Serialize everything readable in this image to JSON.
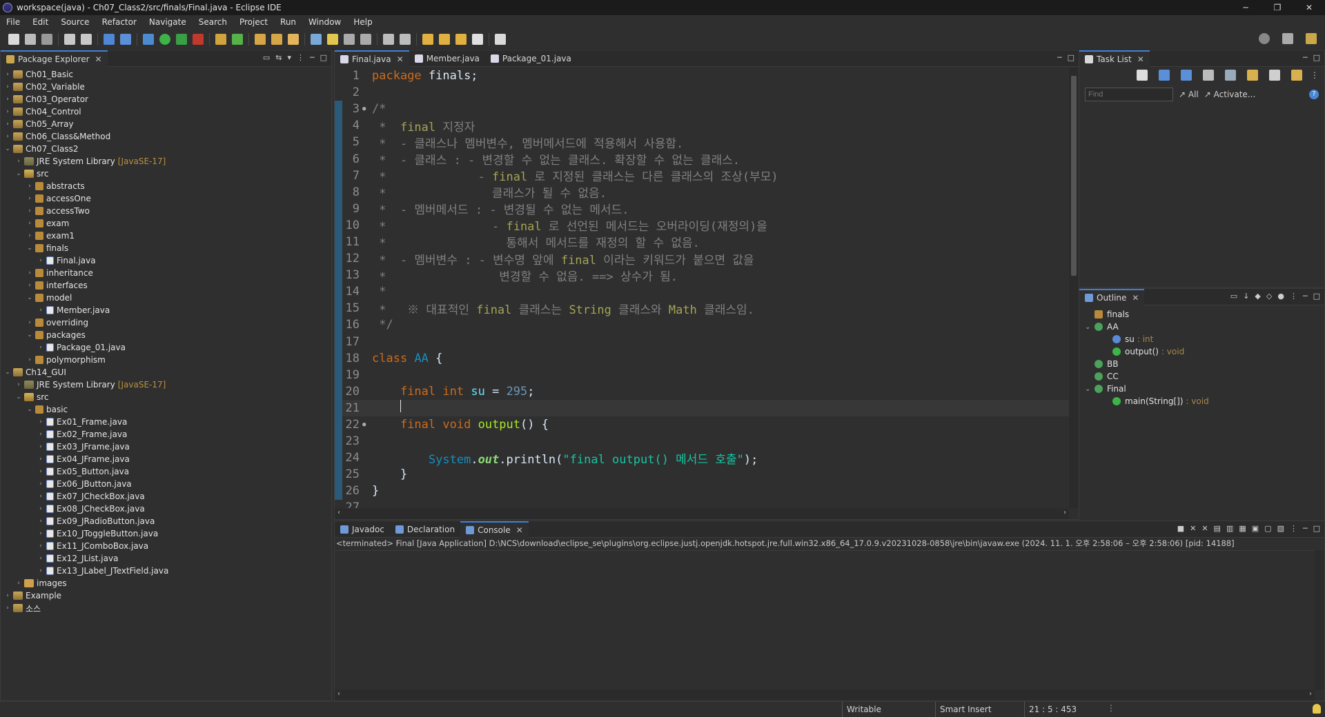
{
  "window": {
    "title": "workspace(java) - Ch07_Class2/src/finals/Final.java - Eclipse IDE",
    "controls": [
      "─",
      "❐",
      "✕"
    ]
  },
  "menu": [
    "File",
    "Edit",
    "Source",
    "Refactor",
    "Navigate",
    "Search",
    "Project",
    "Run",
    "Window",
    "Help"
  ],
  "package_explorer": {
    "tab_label": "Package Explorer",
    "nodes": [
      {
        "label": "Ch01_Basic",
        "depth": 0,
        "twisty": "›",
        "icon": "project-icon"
      },
      {
        "label": "Ch02_Variable",
        "depth": 0,
        "twisty": "›",
        "icon": "project-icon"
      },
      {
        "label": "Ch03_Operator",
        "depth": 0,
        "twisty": "›",
        "icon": "project-icon"
      },
      {
        "label": "Ch04_Control",
        "depth": 0,
        "twisty": "›",
        "icon": "project-icon"
      },
      {
        "label": "Ch05_Array",
        "depth": 0,
        "twisty": "›",
        "icon": "project-icon"
      },
      {
        "label": "Ch06_Class&Method",
        "depth": 0,
        "twisty": "›",
        "icon": "project-icon"
      },
      {
        "label": "Ch07_Class2",
        "depth": 0,
        "twisty": "⌄",
        "icon": "project-icon"
      },
      {
        "label": "JRE System Library",
        "suffix": "[JavaSE-17]",
        "depth": 1,
        "twisty": "›",
        "icon": "library-icon"
      },
      {
        "label": "src",
        "depth": 1,
        "twisty": "⌄",
        "icon": "source-folder-icon"
      },
      {
        "label": "abstracts",
        "depth": 2,
        "twisty": "›",
        "icon": "package-icon"
      },
      {
        "label": "accessOne",
        "depth": 2,
        "twisty": "›",
        "icon": "package-icon"
      },
      {
        "label": "accessTwo",
        "depth": 2,
        "twisty": "›",
        "icon": "package-icon"
      },
      {
        "label": "exam",
        "depth": 2,
        "twisty": "›",
        "icon": "package-icon"
      },
      {
        "label": "exam1",
        "depth": 2,
        "twisty": "›",
        "icon": "package-icon"
      },
      {
        "label": "finals",
        "depth": 2,
        "twisty": "⌄",
        "icon": "package-icon"
      },
      {
        "label": "Final.java",
        "depth": 3,
        "twisty": "›",
        "icon": "java-file-icon"
      },
      {
        "label": "inheritance",
        "depth": 2,
        "twisty": "›",
        "icon": "package-icon"
      },
      {
        "label": "interfaces",
        "depth": 2,
        "twisty": "›",
        "icon": "package-icon"
      },
      {
        "label": "model",
        "depth": 2,
        "twisty": "⌄",
        "icon": "package-icon"
      },
      {
        "label": "Member.java",
        "depth": 3,
        "twisty": "›",
        "icon": "java-file-icon"
      },
      {
        "label": "overriding",
        "depth": 2,
        "twisty": "›",
        "icon": "package-icon"
      },
      {
        "label": "packages",
        "depth": 2,
        "twisty": "⌄",
        "icon": "package-icon"
      },
      {
        "label": "Package_01.java",
        "depth": 3,
        "twisty": "›",
        "icon": "java-file-icon"
      },
      {
        "label": "polymorphism",
        "depth": 2,
        "twisty": "›",
        "icon": "package-icon"
      },
      {
        "label": "Ch14_GUI",
        "depth": 0,
        "twisty": "⌄",
        "icon": "project-icon"
      },
      {
        "label": "JRE System Library",
        "suffix": "[JavaSE-17]",
        "depth": 1,
        "twisty": "›",
        "icon": "library-icon"
      },
      {
        "label": "src",
        "depth": 1,
        "twisty": "⌄",
        "icon": "source-folder-icon"
      },
      {
        "label": "basic",
        "depth": 2,
        "twisty": "⌄",
        "icon": "package-icon"
      },
      {
        "label": "Ex01_Frame.java",
        "depth": 3,
        "twisty": "›",
        "icon": "java-file-icon"
      },
      {
        "label": "Ex02_Frame.java",
        "depth": 3,
        "twisty": "›",
        "icon": "java-file-icon"
      },
      {
        "label": "Ex03_JFrame.java",
        "depth": 3,
        "twisty": "›",
        "icon": "java-file-icon"
      },
      {
        "label": "Ex04_JFrame.java",
        "depth": 3,
        "twisty": "›",
        "icon": "java-file-icon"
      },
      {
        "label": "Ex05_Button.java",
        "depth": 3,
        "twisty": "›",
        "icon": "java-file-icon"
      },
      {
        "label": "Ex06_JButton.java",
        "depth": 3,
        "twisty": "›",
        "icon": "java-file-icon"
      },
      {
        "label": "Ex07_JCheckBox.java",
        "depth": 3,
        "twisty": "›",
        "icon": "java-file-icon"
      },
      {
        "label": "Ex08_JCheckBox.java",
        "depth": 3,
        "twisty": "›",
        "icon": "java-file-icon"
      },
      {
        "label": "Ex09_JRadioButton.java",
        "depth": 3,
        "twisty": "›",
        "icon": "java-file-icon"
      },
      {
        "label": "Ex10_JToggleButton.java",
        "depth": 3,
        "twisty": "›",
        "icon": "java-file-icon"
      },
      {
        "label": "Ex11_JComboBox.java",
        "depth": 3,
        "twisty": "›",
        "icon": "java-file-icon"
      },
      {
        "label": "Ex12_JList.java",
        "depth": 3,
        "twisty": "›",
        "icon": "java-file-icon"
      },
      {
        "label": "Ex13_JLabel_JTextField.java",
        "depth": 3,
        "twisty": "›",
        "icon": "java-file-icon"
      },
      {
        "label": "images",
        "depth": 1,
        "twisty": "›",
        "icon": "folder-icon"
      },
      {
        "label": "Example",
        "depth": 0,
        "twisty": "›",
        "icon": "project-icon"
      },
      {
        "label": "소스",
        "depth": 0,
        "twisty": "›",
        "icon": "project-icon"
      }
    ]
  },
  "editor": {
    "tabs": [
      {
        "label": "Final.java",
        "active": true
      },
      {
        "label": "Member.java",
        "active": false
      },
      {
        "label": "Package_01.java",
        "active": false
      }
    ],
    "lines": [
      {
        "n": "1",
        "fold": "",
        "tokens": [
          {
            "t": "package",
            "c": "kw"
          },
          {
            "t": " finals;",
            "c": "pln"
          }
        ]
      },
      {
        "n": "2",
        "fold": "",
        "tokens": []
      },
      {
        "n": "3",
        "fold": "●",
        "tokens": [
          {
            "t": "/*",
            "c": "cm"
          }
        ]
      },
      {
        "n": "4",
        "fold": "",
        "tokens": [
          {
            "t": " *  ",
            "c": "cm"
          },
          {
            "t": "final",
            "c": "cmk"
          },
          {
            "t": " 지정자",
            "c": "cm"
          }
        ]
      },
      {
        "n": "5",
        "fold": "",
        "tokens": [
          {
            "t": " *  - 클래스나 멤버변수, 멤버메서드에 적용해서 사용함.",
            "c": "cm"
          }
        ]
      },
      {
        "n": "6",
        "fold": "",
        "tokens": [
          {
            "t": " *  - 클래스 : - 변경할 수 없는 클래스. 확장할 수 없는 클래스.",
            "c": "cm"
          }
        ]
      },
      {
        "n": "7",
        "fold": "",
        "tokens": [
          {
            "t": " *             - ",
            "c": "cm"
          },
          {
            "t": "final",
            "c": "cmk"
          },
          {
            "t": " 로 지정된 클래스는 다른 클래스의 조상(부모)",
            "c": "cm"
          }
        ]
      },
      {
        "n": "8",
        "fold": "",
        "tokens": [
          {
            "t": " *               클래스가 될 수 없음.",
            "c": "cm"
          }
        ]
      },
      {
        "n": "9",
        "fold": "",
        "tokens": [
          {
            "t": " *  - 멤버메서드 : - 변경될 수 없는 메서드.",
            "c": "cm"
          }
        ]
      },
      {
        "n": "10",
        "fold": "",
        "tokens": [
          {
            "t": " *               - ",
            "c": "cm"
          },
          {
            "t": "final",
            "c": "cmk"
          },
          {
            "t": " 로 선언된 메서드는 오버라이딩(재정의)을",
            "c": "cm"
          }
        ]
      },
      {
        "n": "11",
        "fold": "",
        "tokens": [
          {
            "t": " *                 통해서 메서드를 재정의 할 수 없음.",
            "c": "cm"
          }
        ]
      },
      {
        "n": "12",
        "fold": "",
        "tokens": [
          {
            "t": " *  - 멤버변수 : - 변수명 앞에 ",
            "c": "cm"
          },
          {
            "t": "final",
            "c": "cmk"
          },
          {
            "t": " 이라는 키워드가 붙으면 값을",
            "c": "cm"
          }
        ]
      },
      {
        "n": "13",
        "fold": "",
        "tokens": [
          {
            "t": " *                변경할 수 없음. ==> 상수가 됨.",
            "c": "cm"
          }
        ]
      },
      {
        "n": "14",
        "fold": "",
        "tokens": [
          {
            "t": " *",
            "c": "cm"
          }
        ]
      },
      {
        "n": "15",
        "fold": "",
        "tokens": [
          {
            "t": " *   ※ 대표적인 ",
            "c": "cm"
          },
          {
            "t": "final",
            "c": "cmk"
          },
          {
            "t": " 클래스는 ",
            "c": "cm"
          },
          {
            "t": "String",
            "c": "cmk"
          },
          {
            "t": " 클래스와 ",
            "c": "cm"
          },
          {
            "t": "Math",
            "c": "cmk"
          },
          {
            "t": " 클래스임.",
            "c": "cm"
          }
        ]
      },
      {
        "n": "16",
        "fold": "",
        "tokens": [
          {
            "t": " */",
            "c": "cm"
          }
        ]
      },
      {
        "n": "17",
        "fold": "",
        "tokens": []
      },
      {
        "n": "18",
        "fold": "",
        "tokens": [
          {
            "t": "class",
            "c": "kw"
          },
          {
            "t": " ",
            "c": "pln"
          },
          {
            "t": "AA",
            "c": "cls"
          },
          {
            "t": " {",
            "c": "pln"
          }
        ]
      },
      {
        "n": "19",
        "fold": "",
        "tokens": []
      },
      {
        "n": "20",
        "fold": "",
        "tokens": [
          {
            "t": "    ",
            "c": "pln"
          },
          {
            "t": "final",
            "c": "kw"
          },
          {
            "t": " ",
            "c": "pln"
          },
          {
            "t": "int",
            "c": "kw"
          },
          {
            "t": " ",
            "c": "pln"
          },
          {
            "t": "su",
            "c": "fld"
          },
          {
            "t": " = ",
            "c": "pln"
          },
          {
            "t": "295",
            "c": "num"
          },
          {
            "t": ";",
            "c": "pln"
          }
        ]
      },
      {
        "n": "21",
        "fold": "",
        "tokens": [
          {
            "t": "    ",
            "c": "pln"
          }
        ],
        "caret": true
      },
      {
        "n": "22",
        "fold": "●",
        "tokens": [
          {
            "t": "    ",
            "c": "pln"
          },
          {
            "t": "final",
            "c": "kw"
          },
          {
            "t": " ",
            "c": "pln"
          },
          {
            "t": "void",
            "c": "kw"
          },
          {
            "t": " ",
            "c": "pln"
          },
          {
            "t": "output",
            "c": "mth"
          },
          {
            "t": "() {",
            "c": "pln"
          }
        ]
      },
      {
        "n": "23",
        "fold": "",
        "tokens": []
      },
      {
        "n": "24",
        "fold": "",
        "tokens": [
          {
            "t": "        ",
            "c": "pln"
          },
          {
            "t": "System",
            "c": "cls"
          },
          {
            "t": ".",
            "c": "pln"
          },
          {
            "t": "out",
            "c": "sta"
          },
          {
            "t": ".println(",
            "c": "pln"
          },
          {
            "t": "\"final output() 메서드 호출\"",
            "c": "str"
          },
          {
            "t": ");",
            "c": "pln"
          }
        ]
      },
      {
        "n": "25",
        "fold": "",
        "tokens": [
          {
            "t": "    }",
            "c": "pln"
          }
        ]
      },
      {
        "n": "26",
        "fold": "",
        "tokens": [
          {
            "t": "}",
            "c": "pln"
          }
        ]
      },
      {
        "n": "27",
        "fold": "",
        "tokens": []
      }
    ],
    "current_line": "21"
  },
  "task_list": {
    "tab_label": "Task List",
    "find_placeholder": "Find",
    "all_label": "All",
    "activate_label": "Activate..."
  },
  "outline": {
    "tab_label": "Outline",
    "nodes": [
      {
        "label": "finals",
        "type": "",
        "depth": 0,
        "twisty": "",
        "icon": "package-icon"
      },
      {
        "label": "AA",
        "type": "",
        "depth": 0,
        "twisty": "⌄",
        "icon": "class-icon"
      },
      {
        "label": "su",
        "type": ": int",
        "depth": 1,
        "twisty": "",
        "icon": "field-icon"
      },
      {
        "label": "output()",
        "type": ": void",
        "depth": 1,
        "twisty": "",
        "icon": "method-icon"
      },
      {
        "label": "BB",
        "type": "",
        "depth": 0,
        "twisty": "",
        "icon": "class-icon"
      },
      {
        "label": "CC",
        "type": "",
        "depth": 0,
        "twisty": "",
        "icon": "class-icon"
      },
      {
        "label": "Final",
        "type": "",
        "depth": 0,
        "twisty": "⌄",
        "icon": "class-icon"
      },
      {
        "label": "main(String[])",
        "type": ": void",
        "depth": 1,
        "twisty": "",
        "icon": "method-icon"
      }
    ]
  },
  "bottom_panel": {
    "tabs": [
      {
        "label": "Javadoc",
        "active": false
      },
      {
        "label": "Declaration",
        "active": false
      },
      {
        "label": "Console",
        "active": true
      }
    ],
    "console_header": "<terminated> Final [Java Application] D:\\NCS\\download\\eclipse_se\\plugins\\org.eclipse.justj.openjdk.hotspot.jre.full.win32.x86_64_17.0.9.v20231028-0858\\jre\\bin\\javaw.exe  (2024. 11. 1. 오후 2:58:06 – 오후 2:58:06) [pid: 14188]"
  },
  "status_bar": {
    "writable": "Writable",
    "insert_mode": "Smart Insert",
    "position": "21 : 5 : 453"
  },
  "colors": {
    "accent": "#3d7ed6",
    "keyword": "#cc6c1d",
    "comment": "#808080",
    "string": "#17c6a3"
  }
}
